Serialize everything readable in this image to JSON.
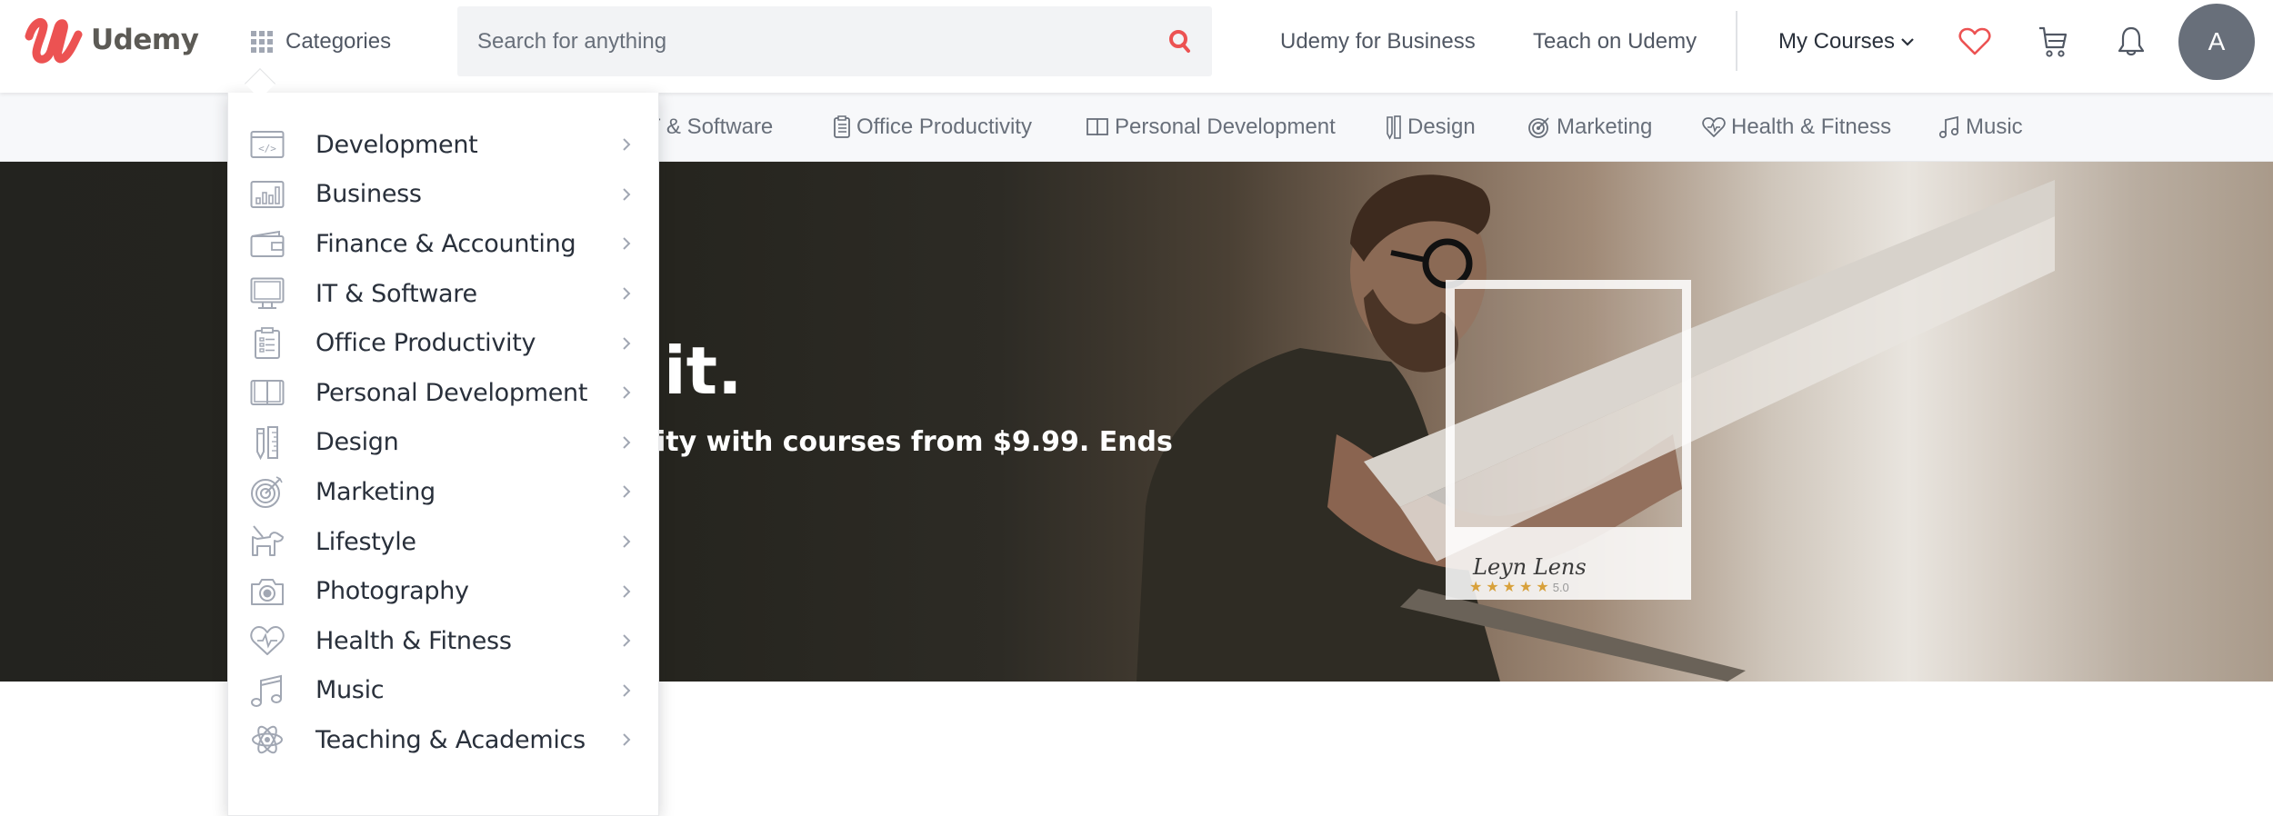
{
  "header": {
    "logo_text": "Udemy",
    "categories_label": "Categories",
    "search_placeholder": "Search for anything",
    "search_value": "",
    "links": {
      "business": "Udemy for Business",
      "teach": "Teach on Udemy"
    },
    "my_courses": "My Courses",
    "avatar_initial": "A",
    "brand_color": "#ec5252"
  },
  "subnav": {
    "items": [
      {
        "label": "IT & Software",
        "visible_text": "T & Software",
        "icon": "monitor-icon"
      },
      {
        "label": "Office Productivity",
        "icon": "clipboard-icon"
      },
      {
        "label": "Personal Development",
        "icon": "book-icon"
      },
      {
        "label": "Design",
        "icon": "pencil-ruler-icon"
      },
      {
        "label": "Marketing",
        "icon": "target-icon"
      },
      {
        "label": "Health & Fitness",
        "icon": "heart-pulse-icon"
      },
      {
        "label": "Music",
        "icon": "music-note-icon"
      }
    ]
  },
  "hero": {
    "title_fragment": "it.",
    "subtitle_fragment": "ity with courses from $9.99. Ends",
    "polaroid": {
      "signature": "Leyn Lens",
      "rating": "5.0",
      "stars": 5
    }
  },
  "dropdown": {
    "items": [
      {
        "label": "Development",
        "icon": "code-window-icon"
      },
      {
        "label": "Business",
        "icon": "bar-chart-icon"
      },
      {
        "label": "Finance & Accounting",
        "icon": "wallet-icon"
      },
      {
        "label": "IT & Software",
        "icon": "monitor-icon"
      },
      {
        "label": "Office Productivity",
        "icon": "clipboard-icon"
      },
      {
        "label": "Personal Development",
        "icon": "book-icon"
      },
      {
        "label": "Design",
        "icon": "pencil-ruler-icon"
      },
      {
        "label": "Marketing",
        "icon": "target-icon"
      },
      {
        "label": "Lifestyle",
        "icon": "dog-icon"
      },
      {
        "label": "Photography",
        "icon": "camera-icon"
      },
      {
        "label": "Health & Fitness",
        "icon": "heart-pulse-icon"
      },
      {
        "label": "Music",
        "icon": "music-note-icon"
      },
      {
        "label": "Teaching & Academics",
        "icon": "atom-icon"
      }
    ]
  }
}
